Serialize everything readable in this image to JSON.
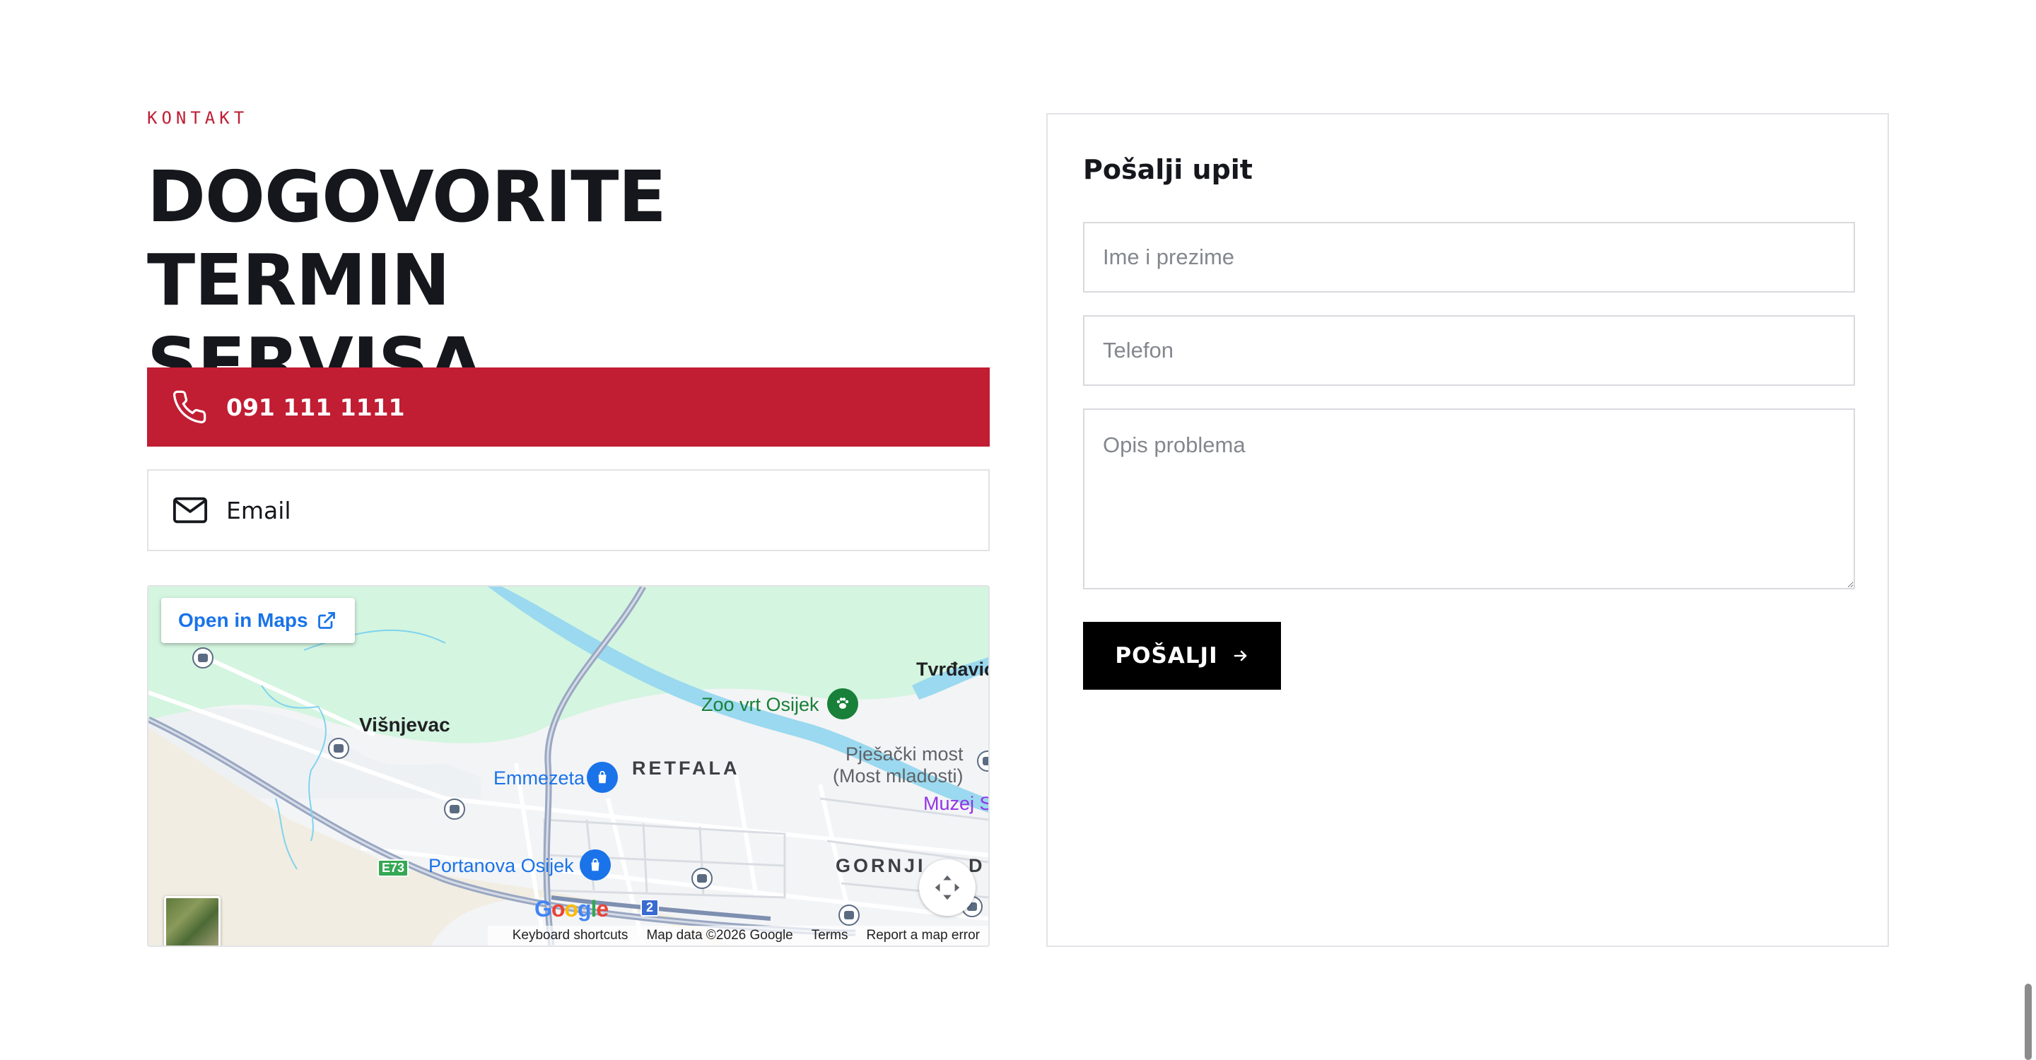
{
  "contact": {
    "eyebrow": "KONTAKT",
    "headline_line1": "DOGOVORITE TERMIN",
    "headline_line2": "SERVISA",
    "phone": "091 111 1111",
    "email_label": "Email"
  },
  "map": {
    "open_in_maps": "Open in Maps",
    "places": {
      "visnjevac": "Višnjevac",
      "retfala": "RETFALA",
      "emmezeta": "Emmezeta",
      "portanova": "Portanova Osijek",
      "zoo": "Zoo vrt Osijek",
      "pjesacki_1": "Pješački most",
      "pjesacki_2": "(Most mladosti)",
      "tvrdavica": "Tvrđavic",
      "muzej": "Muzej S",
      "gornji": "GORNJI",
      "gornji_d": "D",
      "e73": "E73",
      "route2": "2"
    },
    "google": "Google",
    "footer": {
      "shortcuts": "Keyboard shortcuts",
      "map_data": "Map data ©2026 Google",
      "terms": "Terms",
      "report": "Report a map error"
    }
  },
  "form": {
    "title": "Pošalji upit",
    "name_placeholder": "Ime i prezime",
    "phone_placeholder": "Telefon",
    "description_placeholder": "Opis problema",
    "submit_label": "POŠALJI"
  },
  "colors": {
    "accent": "#c11d33",
    "text": "#15171c",
    "button": "#000000",
    "link": "#1a73e8"
  }
}
